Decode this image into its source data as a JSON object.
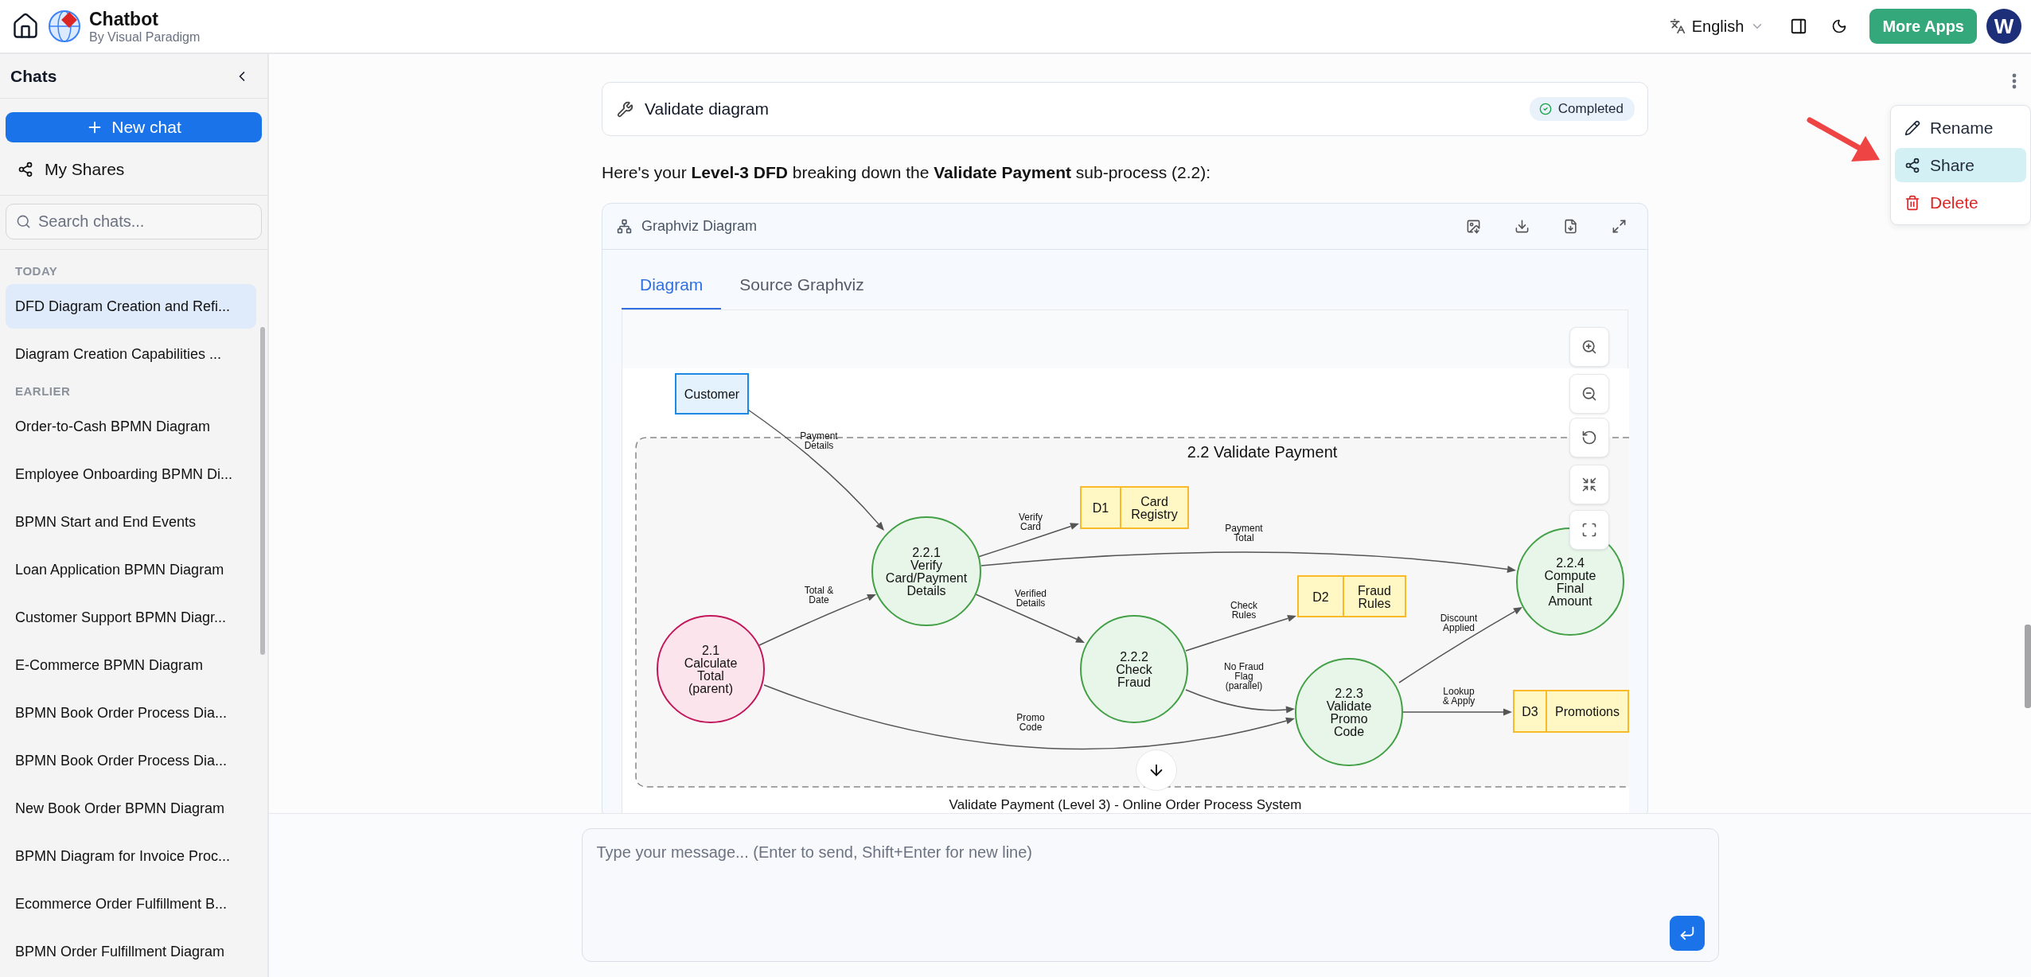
{
  "header": {
    "title": "Chatbot",
    "subtitle": "By Visual Paradigm",
    "language": "English",
    "more_apps": "More Apps",
    "avatar": "W"
  },
  "sidebar": {
    "title": "Chats",
    "new_chat": "New chat",
    "my_shares": "My Shares",
    "search": {
      "placeholder": "Search chats..."
    },
    "groups": [
      {
        "label": "TODAY",
        "items": [
          {
            "label": "DFD Diagram Creation and Refi...",
            "selected": true
          },
          {
            "label": "Diagram Creation Capabilities ...",
            "selected": false
          }
        ]
      },
      {
        "label": "EARLIER",
        "items": [
          {
            "label": "Order-to-Cash BPMN Diagram",
            "selected": false
          },
          {
            "label": "Employee Onboarding BPMN Di...",
            "selected": false
          },
          {
            "label": "BPMN Start and End Events",
            "selected": false
          },
          {
            "label": "Loan Application BPMN Diagram",
            "selected": false
          },
          {
            "label": "Customer Support BPMN Diagr...",
            "selected": false
          },
          {
            "label": "E-Commerce BPMN Diagram",
            "selected": false
          },
          {
            "label": "BPMN Book Order Process Dia...",
            "selected": false
          },
          {
            "label": "BPMN Book Order Process Dia...",
            "selected": false
          },
          {
            "label": "New Book Order BPMN Diagram",
            "selected": false
          },
          {
            "label": "BPMN Diagram for Invoice Proc...",
            "selected": false
          },
          {
            "label": "Ecommerce Order Fulfillment B...",
            "selected": false
          },
          {
            "label": "BPMN Order Fulfillment Diagram",
            "selected": false
          }
        ]
      }
    ]
  },
  "chat": {
    "tool_call": {
      "title": "Validate diagram",
      "status": "Completed"
    },
    "message": "Here's your **Level-3 DFD** breaking down the **Validate Payment** sub-process (2.2):",
    "diagram_card": {
      "title": "Graphviz Diagram",
      "tabs": [
        {
          "label": "Diagram",
          "selected": true
        },
        {
          "label": "Source Graphviz",
          "selected": false
        }
      ],
      "diagram": {
        "cluster": "2.2 Validate Payment",
        "caption": "Validate Payment (Level 3) - Online Order Process System",
        "nodes": [
          {
            "kind": "external",
            "lines": [
              "Customer"
            ]
          },
          {
            "kind": "parent",
            "lines": [
              "2.1",
              "Calculate",
              "Total",
              "(parent)"
            ]
          },
          {
            "kind": "process",
            "lines": [
              "2.2.1",
              "Verify",
              "Card/Payment",
              "Details"
            ]
          },
          {
            "kind": "datastore",
            "id_text": "D1",
            "lines": [
              "Card",
              "Registry"
            ]
          },
          {
            "kind": "process",
            "lines": [
              "2.2.2",
              "Check",
              "Fraud"
            ]
          },
          {
            "kind": "datastore",
            "id_text": "D2",
            "lines": [
              "Fraud",
              "Rules"
            ]
          },
          {
            "kind": "process",
            "lines": [
              "2.2.3",
              "Validate",
              "Promo",
              "Code"
            ]
          },
          {
            "kind": "process",
            "lines": [
              "2.2.4",
              "Compute",
              "Final",
              "Amount"
            ]
          },
          {
            "kind": "datastore",
            "id_text": "D3",
            "lines": [
              "Promotions"
            ]
          }
        ],
        "edges": [
          {
            "lines": [
              "Payment",
              "Details"
            ]
          },
          {
            "lines": [
              "Total &",
              "Date"
            ]
          },
          {
            "lines": [
              "Verify",
              "Card"
            ]
          },
          {
            "lines": [
              "Payment",
              "Total"
            ]
          },
          {
            "lines": [
              "Verified",
              "Details"
            ]
          },
          {
            "lines": [
              "Check",
              "Rules"
            ]
          },
          {
            "lines": [
              "No Fraud",
              "Flag",
              "(parallel)"
            ]
          },
          {
            "lines": [
              "Promo",
              "Code"
            ]
          },
          {
            "lines": [
              "Discount",
              "Applied"
            ]
          },
          {
            "lines": [
              "Lookup",
              "& Apply"
            ]
          }
        ]
      }
    }
  },
  "menu": {
    "items": [
      {
        "label": "Rename",
        "kind": "rename",
        "selected": false
      },
      {
        "label": "Share",
        "kind": "share",
        "selected": true
      },
      {
        "label": "Delete",
        "kind": "delete",
        "selected": false
      }
    ]
  },
  "composer": {
    "placeholder": "Type your message... (Enter to send, Shift+Enter for new line)"
  }
}
